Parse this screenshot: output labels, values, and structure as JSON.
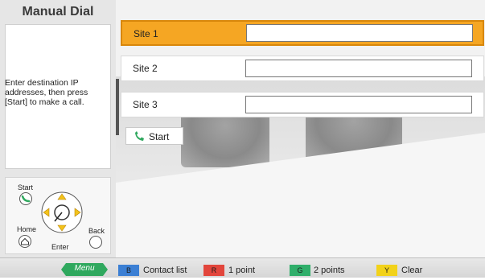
{
  "title": "Manual Dial",
  "instructions": "Enter destination IP addresses, then press [Start] to make a call.",
  "controls": {
    "start": "Start",
    "home": "Home",
    "back": "Back",
    "enter": "Enter"
  },
  "sites": [
    {
      "label": "Site 1",
      "value": ""
    },
    {
      "label": "Site 2",
      "value": ""
    },
    {
      "label": "Site 3",
      "value": ""
    }
  ],
  "start_button": "Start",
  "bottom_bar": {
    "menu": "Menu",
    "keys": [
      {
        "key": "B",
        "label": "Contact list",
        "color": "#3b7fd4"
      },
      {
        "key": "R",
        "label": "1 point",
        "color": "#e2463c"
      },
      {
        "key": "G",
        "label": "2 points",
        "color": "#2fae6a"
      },
      {
        "key": "Y",
        "label": "Clear",
        "color": "#f2d21a"
      }
    ]
  },
  "colors": {
    "accent": "#f5a623",
    "menu_green": "#2fa85e"
  }
}
